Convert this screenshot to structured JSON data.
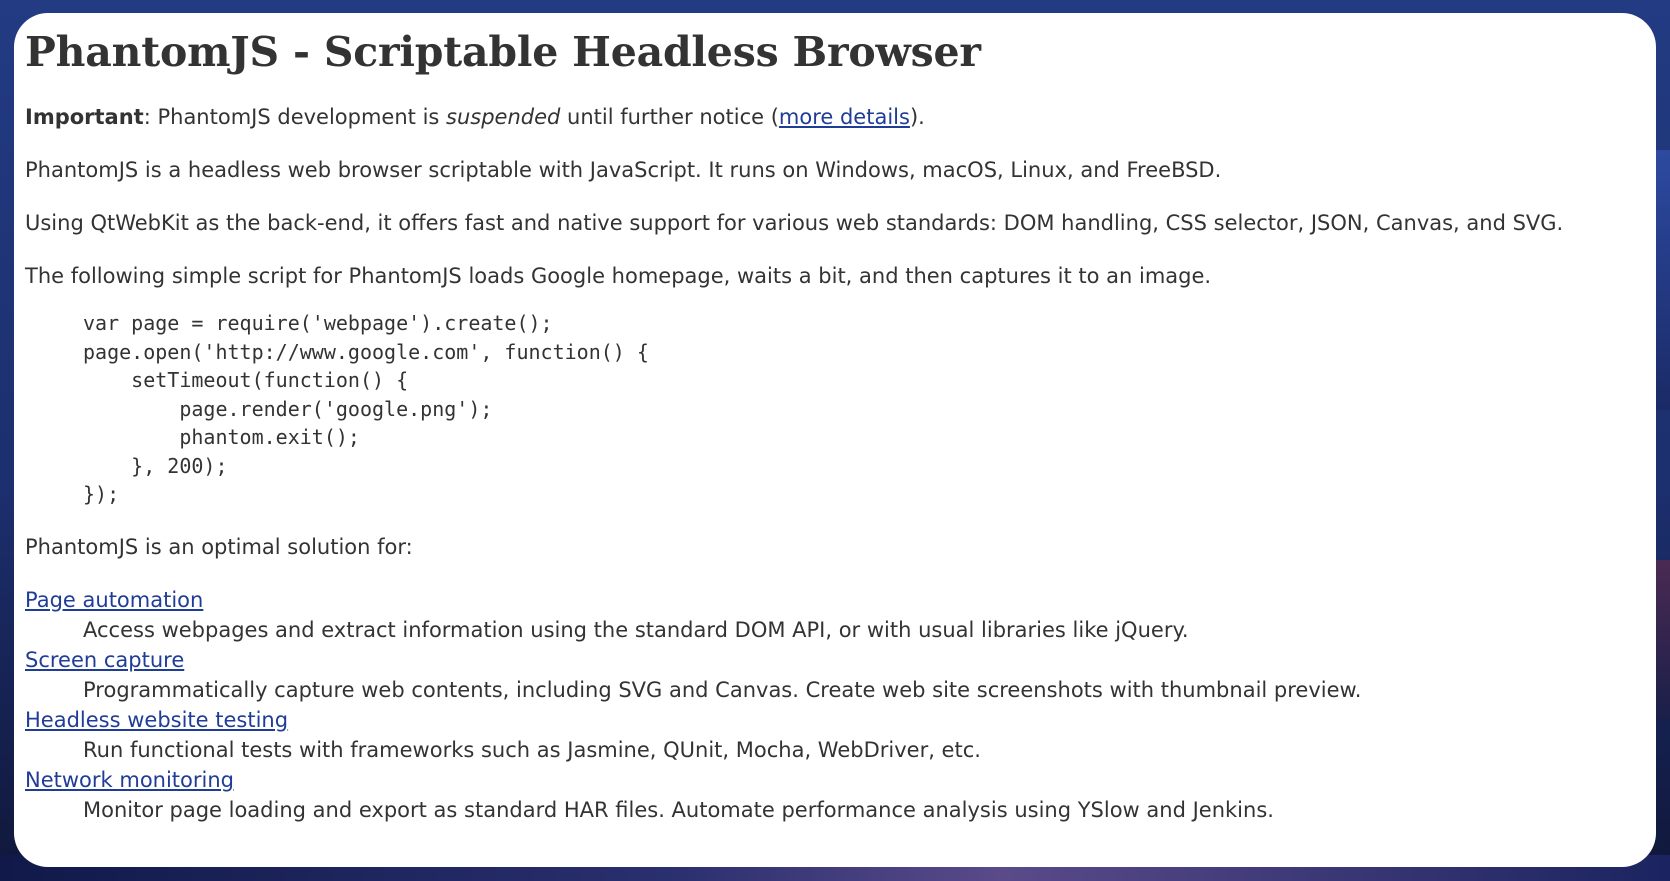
{
  "page": {
    "title": "PhantomJS - Scriptable Headless Browser",
    "important": {
      "label": "Important",
      "text_before": ": PhantomJS development is ",
      "emphasis": "suspended",
      "text_after": " until further notice (",
      "link_label": "more details",
      "text_end": ")."
    },
    "paragraphs": [
      "PhantomJS is a headless web browser scriptable with JavaScript. It runs on Windows, macOS, Linux, and FreeBSD.",
      "Using QtWebKit as the back-end, it offers fast and native support for various web standards: DOM handling, CSS selector, JSON, Canvas, and SVG.",
      "The following simple script for PhantomJS loads Google homepage, waits a bit, and then captures it to an image."
    ],
    "code": "var page = require('webpage').create();\npage.open('http://www.google.com', function() {\n    setTimeout(function() {\n        page.render('google.png');\n        phantom.exit();\n    }, 200);\n});",
    "optimal_intro": "PhantomJS is an optimal solution for:",
    "use_cases": [
      {
        "title": "Page automation",
        "description": "Access webpages and extract information using the standard DOM API, or with usual libraries like jQuery."
      },
      {
        "title": "Screen capture",
        "description": "Programmatically capture web contents, including SVG and Canvas. Create web site screenshots with thumbnail preview."
      },
      {
        "title": "Headless website testing",
        "description": "Run functional tests with frameworks such as Jasmine, QUnit, Mocha, WebDriver, etc."
      },
      {
        "title": "Network monitoring",
        "description": "Monitor page loading and export as standard HAR files. Automate performance analysis using YSlow and Jenkins."
      }
    ]
  },
  "colors": {
    "text": "#333333",
    "link": "#1f3c97",
    "card_background": "#ffffff",
    "page_background": "#223b82"
  }
}
